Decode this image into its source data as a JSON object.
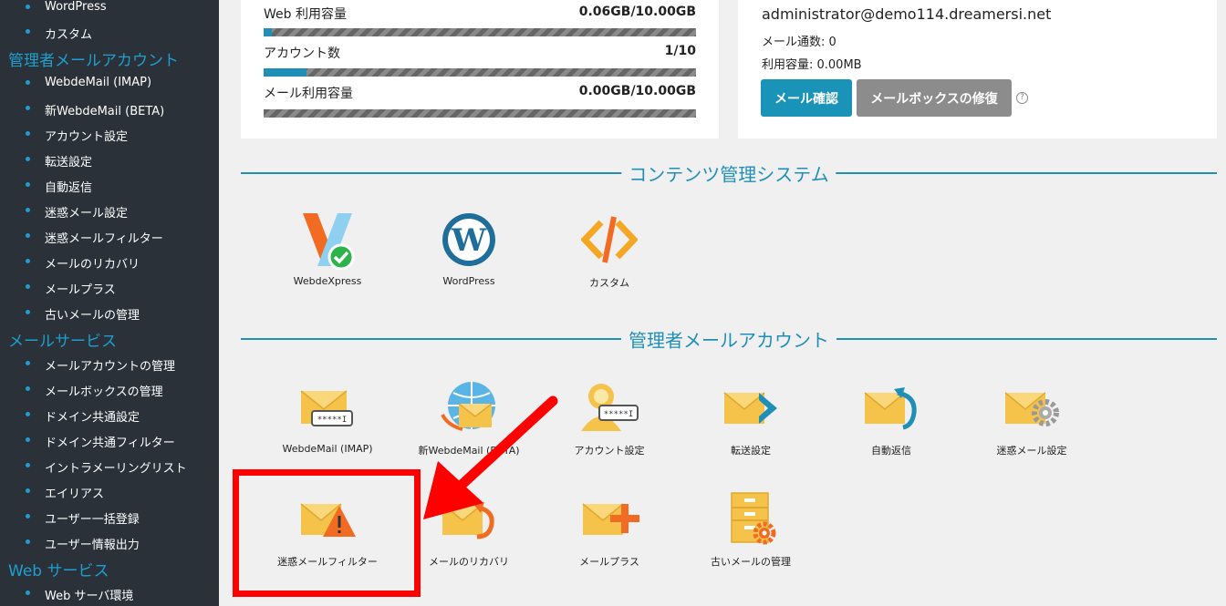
{
  "sidebar": {
    "top_items": [
      "WordPress",
      "カスタム"
    ],
    "admin_mail": {
      "title": "管理者メールアカウント",
      "items": [
        "WebdeMail (IMAP)",
        "新WebdeMail (BETA)",
        "アカウント設定",
        "転送設定",
        "自動返信",
        "迷惑メール設定",
        "迷惑メールフィルター",
        "メールのリカバリ",
        "メールプラス",
        "古いメールの管理"
      ]
    },
    "mail_service": {
      "title": "メールサービス",
      "items": [
        "メールアカウントの管理",
        "メールボックスの管理",
        "ドメイン共通設定",
        "ドメイン共通フィルター",
        "イントラメーリングリスト",
        "エイリアス",
        "ユーザー一括登録",
        "ユーザー情報出力"
      ]
    },
    "web_service": {
      "title": "Web サービス",
      "items": [
        "Web サーバ環境"
      ]
    }
  },
  "usage": [
    {
      "label": "Web 利用容量",
      "value": "0.06GB/10.00GB",
      "fraction": 0.006
    },
    {
      "label": "アカウント数",
      "value": "1/10",
      "fraction": 0.1
    },
    {
      "label": "メール利用容量",
      "value": "0.00GB/10.00GB",
      "fraction": 0.0
    }
  ],
  "mail_panel": {
    "address": "administrator@demo114.dreamersi.net",
    "count_line": "メール通数: 0",
    "usage_line": "利用容量: 0.00MB",
    "check_button": "メール確認",
    "repair_button": "メールボックスの修復",
    "help": "?"
  },
  "cms": {
    "title": "コンテンツ管理システム",
    "tiles": [
      "WebdeXpress",
      "WordPress",
      "カスタム"
    ]
  },
  "admin_accounts": {
    "title": "管理者メールアカウント",
    "tiles": [
      "WebdeMail (IMAP)",
      "新WebdeMail (BETA)",
      "アカウント設定",
      "転送設定",
      "自動返信",
      "迷惑メール設定",
      "迷惑メールフィルター",
      "メールのリカバリ",
      "メールプラス",
      "古いメールの管理"
    ]
  },
  "colors": {
    "accent": "#1f8fb8",
    "highlight": "#ff0000",
    "button_blue": "#1a93b8",
    "button_gray": "#8c8c8c"
  }
}
